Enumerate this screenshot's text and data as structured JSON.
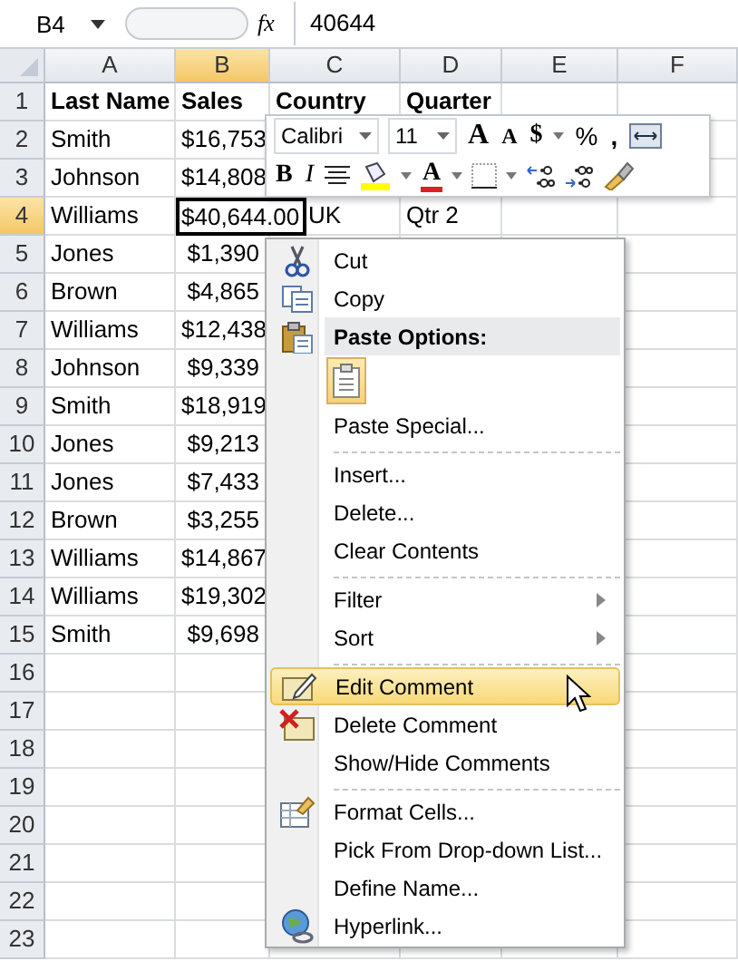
{
  "formula_bar": {
    "name_box": "B4",
    "fx": "fx",
    "value": "40644"
  },
  "columns": [
    {
      "label": "A",
      "selected": false
    },
    {
      "label": "B",
      "selected": true
    },
    {
      "label": "C",
      "selected": false
    },
    {
      "label": "D",
      "selected": false
    },
    {
      "label": "E",
      "selected": false
    },
    {
      "label": "F",
      "selected": false
    }
  ],
  "rows": [
    {
      "number": "1",
      "selected": false,
      "a": "Last Name",
      "b": "Sales",
      "c": "Country",
      "d": "Quarter"
    },
    {
      "number": "2",
      "selected": false,
      "a": "Smith",
      "b": "$16,753"
    },
    {
      "number": "3",
      "selected": false,
      "a": "Johnson",
      "b": "$14,808"
    },
    {
      "number": "4",
      "selected": true,
      "a": "Williams",
      "b": "$40,644.00",
      "c": "UK",
      "d": "Qtr 2"
    },
    {
      "number": "5",
      "selected": false,
      "a": "Jones",
      "b": "$1,390"
    },
    {
      "number": "6",
      "selected": false,
      "a": "Brown",
      "b": "$4,865"
    },
    {
      "number": "7",
      "selected": false,
      "a": "Williams",
      "b": "$12,438"
    },
    {
      "number": "8",
      "selected": false,
      "a": "Johnson",
      "b": "$9,339"
    },
    {
      "number": "9",
      "selected": false,
      "a": "Smith",
      "b": "$18,919"
    },
    {
      "number": "10",
      "selected": false,
      "a": "Jones",
      "b": "$9,213"
    },
    {
      "number": "11",
      "selected": false,
      "a": "Jones",
      "b": "$7,433"
    },
    {
      "number": "12",
      "selected": false,
      "a": "Brown",
      "b": "$3,255"
    },
    {
      "number": "13",
      "selected": false,
      "a": "Williams",
      "b": "$14,867"
    },
    {
      "number": "14",
      "selected": false,
      "a": "Williams",
      "b": "$19,302"
    },
    {
      "number": "15",
      "selected": false,
      "a": "Smith",
      "b": "$9,698"
    },
    {
      "number": "16",
      "selected": false
    },
    {
      "number": "17",
      "selected": false
    },
    {
      "number": "18",
      "selected": false
    },
    {
      "number": "19",
      "selected": false
    },
    {
      "number": "20",
      "selected": false
    },
    {
      "number": "21",
      "selected": false
    },
    {
      "number": "22",
      "selected": false
    },
    {
      "number": "23",
      "selected": false
    }
  ],
  "mini_toolbar": {
    "font": "Calibri",
    "size": "11",
    "grow_font": "A",
    "shrink_font": "A",
    "currency": "$",
    "percent": "%",
    "comma": ",",
    "bold": "B",
    "italic": "I",
    "font_color": "A"
  },
  "context_menu": [
    {
      "kind": "item",
      "label": "Cut",
      "submenu": false,
      "selected": false
    },
    {
      "kind": "item",
      "label": "Copy",
      "submenu": false,
      "selected": false
    },
    {
      "kind": "header",
      "label": "Paste Options:"
    },
    {
      "kind": "paste"
    },
    {
      "kind": "item",
      "label": "Paste Special...",
      "submenu": false,
      "selected": false
    },
    {
      "kind": "separator"
    },
    {
      "kind": "item",
      "label": "Insert...",
      "submenu": false,
      "selected": false
    },
    {
      "kind": "item",
      "label": "Delete...",
      "submenu": false,
      "selected": false
    },
    {
      "kind": "item",
      "label": "Clear Contents",
      "submenu": false,
      "selected": false
    },
    {
      "kind": "separator"
    },
    {
      "kind": "item",
      "label": "Filter",
      "submenu": true,
      "selected": false
    },
    {
      "kind": "item",
      "label": "Sort",
      "submenu": true,
      "selected": false
    },
    {
      "kind": "separator"
    },
    {
      "kind": "item",
      "label": "Edit Comment",
      "submenu": false,
      "selected": true
    },
    {
      "kind": "item",
      "label": "Delete Comment",
      "submenu": false,
      "selected": false
    },
    {
      "kind": "item",
      "label": "Show/Hide Comments",
      "submenu": false,
      "selected": false
    },
    {
      "kind": "separator"
    },
    {
      "kind": "item",
      "label": "Format Cells...",
      "submenu": false,
      "selected": false
    },
    {
      "kind": "item",
      "label": "Pick From Drop-down List...",
      "submenu": false,
      "selected": false
    },
    {
      "kind": "item",
      "label": "Define Name...",
      "submenu": false,
      "selected": false
    },
    {
      "kind": "item",
      "label": "Hyperlink...",
      "submenu": false,
      "selected": false
    }
  ]
}
